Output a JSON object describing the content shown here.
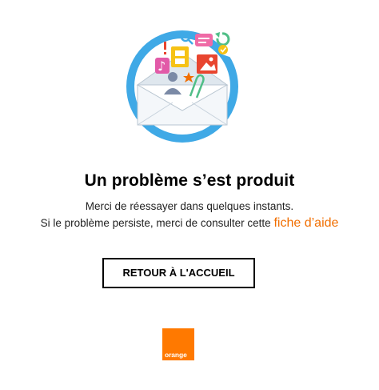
{
  "error": {
    "title": "Un problème s’est produit",
    "message_line1": "Merci de réessayer dans quelques instants.",
    "message_line2_prefix": "Si le problème persiste, merci de consulter cette",
    "help_link_label": "fiche d’aide"
  },
  "actions": {
    "home_button_label": "RETOUR À L'ACCUEIL"
  },
  "brand": {
    "logo_text": "orange",
    "logo_color": "#ff7900",
    "accent_color": "#f16e00"
  },
  "illustration": {
    "icon": "envelope-with-media-icons"
  }
}
